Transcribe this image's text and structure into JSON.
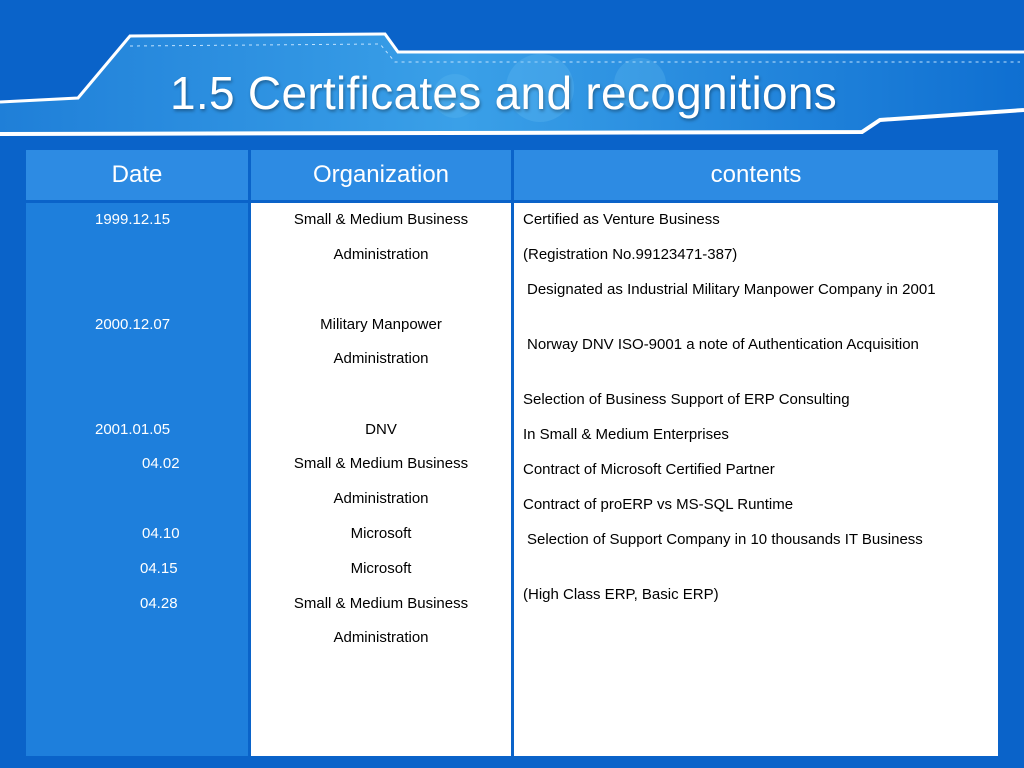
{
  "slide": {
    "title": "1.5 Certificates and recognitions"
  },
  "table": {
    "headers": [
      "Date",
      "Organization",
      "contents"
    ],
    "dates": [
      "1999.12.15",
      "2000.12.07",
      "2001.01.05",
      "04.02",
      "04.10",
      "04.15",
      "04.28"
    ],
    "organizations": [
      "Small & Medium Business",
      "Administration",
      "Military Manpower",
      "Administration",
      "DNV",
      "Small & Medium Business",
      "Administration",
      "Microsoft",
      "Microsoft",
      "Small & Medium Business",
      "Administration"
    ],
    "contents": [
      "Certified as Venture Business",
      "(Registration No.99123471-387)",
      "Designated as Industrial Military Manpower Company in 2001",
      "Norway DNV ISO-9001 a note of Authentication Acquisition",
      "Selection of Business Support of ERP Consulting",
      "In Small & Medium Enterprises",
      "Contract of Microsoft Certified Partner",
      "Contract of proERP vs MS-SQL Runtime",
      "Selection of Support Company in 10 thousands IT Business",
      "(High Class ERP, Basic ERP)"
    ]
  },
  "colors": {
    "background": "#0a63c9",
    "header": "#2d8be3",
    "date_column": "#1e7fdc",
    "text_light": "#ffffff",
    "text_dark": "#000000"
  }
}
